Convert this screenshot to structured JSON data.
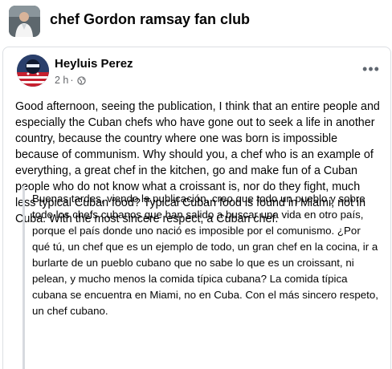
{
  "group": {
    "name": "chef Gordon ramsay fan club",
    "avatar_icon": "group-photo-icon"
  },
  "post": {
    "author": "Heyluis Perez",
    "time": "2 h",
    "separator": "·",
    "audience_icon": "globe-icon",
    "more_icon": "more-options-icon",
    "more_label": "•••",
    "body": "Good afternoon, seeing the publication, I think that an entire people and especially the Cuban chefs who have gone out to seek a life in another country, because the country where one was born is impossible because of communism. Why should you, a chef who is an example of everything, a great chef in the kitchen, go and make fun of a Cuban people who do not know what a croissant is, nor do they fight, much less typical Cuban food? Typical Cuban food is found in Miami, not in Cuba. With the most sincere respect, a Cuban chef.",
    "quote": "Buenas tardes, viendo la publicación, creo que todo un pueblo y sobre todo los chefs cubanos que han salido a buscar una vida en otro país, porque el país donde uno nació es imposible por el comunismo. ¿Por qué tú, un chef que es un ejemplo de todo, un gran chef en la cocina, ir a burlarte de un pueblo cubano que no sabe lo que es un croissant, ni pelean, y mucho menos la comida típica cubana? La comida típica cubana se encuentra en Miami, no en Cuba. Con el más sincero respeto, un chef cubano."
  },
  "colors": {
    "text_primary": "#050505",
    "text_secondary": "#65676b",
    "card_border": "#dcdfe3",
    "quote_bar": "#d7dadf"
  }
}
